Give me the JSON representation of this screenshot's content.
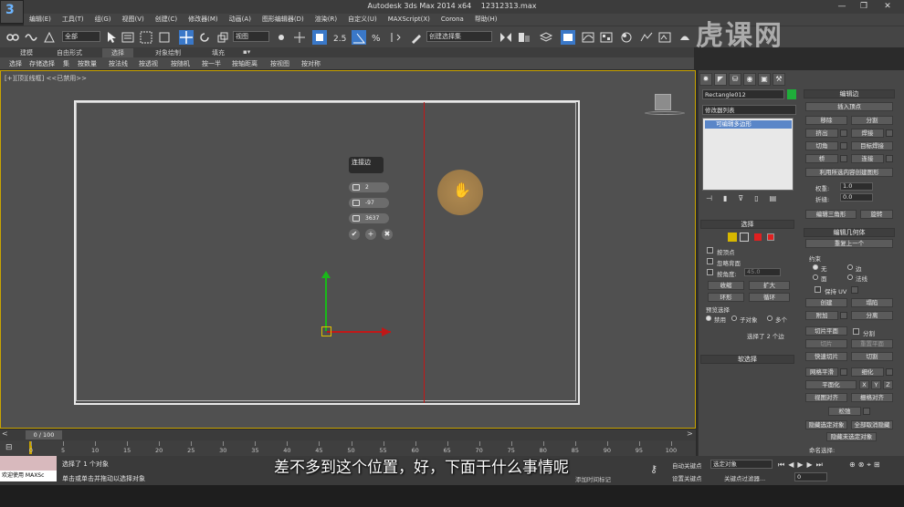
{
  "app": {
    "title_app": "Autodesk 3ds Max  2014 x64",
    "title_file": "12312313.max",
    "logo": "3"
  },
  "menu": [
    "编辑(E)",
    "工具(T)",
    "组(G)",
    "视图(V)",
    "创建(C)",
    "修改器(M)",
    "动画(A)",
    "图形编辑器(D)",
    "渲染(R)",
    "自定义(U)",
    "MAXScript(X)",
    "Corona",
    "帮助(H)"
  ],
  "toolbar": {
    "filter_value": "全部",
    "refcoord_value": "视图",
    "named_sel_value": "创建选择集"
  },
  "ribbon": {
    "tabs": [
      "建模",
      "自由形式",
      "选择",
      "对象绘制",
      "填充"
    ],
    "items": [
      "选择",
      "存储选择",
      "集",
      "按数量",
      "按法线",
      "按透视",
      "按随机",
      "按一半",
      "按轴距离",
      "按视图",
      "按对称"
    ]
  },
  "viewport": {
    "label": "[+][顶][线框]  <<已禁用>>",
    "caddy": {
      "title": "连接边",
      "segments": "2",
      "pinch": "-97",
      "slide": "3637"
    }
  },
  "command_panel": {
    "object_name": "Rectangle012",
    "object_color": "#1fae3a",
    "modifier_list_label": "修改器列表",
    "stack_item": "可编辑多边形",
    "selection": {
      "header": "选择",
      "by_vertex": "按顶点",
      "ignore_backfacing": "忽略背面",
      "by_angle": "按角度:",
      "angle_value": "45.0",
      "shrink": "收缩",
      "grow": "扩大",
      "ring": "环形",
      "loop": "循环",
      "preview_label": "预览选择",
      "preview_opts": [
        "禁用",
        "子对象",
        "多个"
      ],
      "status": "选择了 2 个边"
    },
    "soft_selection": "软选择",
    "edit_edges": {
      "header": "编辑边",
      "insert_vertex": "插入顶点",
      "remove": "移除",
      "split": "分割",
      "extrude": "挤出",
      "weld": "焊接",
      "chamfer": "切角",
      "target_weld": "目标焊接",
      "bridge": "桥",
      "connect": "连接",
      "create_shape": "利用所选内容创建图形",
      "weight_label": "权重:",
      "weight_value": "1.0",
      "crease_label": "折缝:",
      "crease_value": "0.0",
      "edit_tri": "编辑三角形",
      "turn": "旋转"
    },
    "edit_geometry": {
      "header": "编辑几何体",
      "repeat_last": "重复上一个",
      "constraints": "约束",
      "c_none": "无",
      "c_edge": "边",
      "c_face": "面",
      "c_normal": "法线",
      "preserve_uv": "保持 UV",
      "create": "创建",
      "collapse": "塌陷",
      "attach": "附加",
      "detach": "分离",
      "slice_plane": "切片平面",
      "split": "分割",
      "slice": "切片",
      "reset_plane": "重置平面",
      "quickslice": "快速切片",
      "cut": "切割",
      "meshsmooth": "网格平滑",
      "tessellate": "细化",
      "make_planar": "平面化",
      "x": "X",
      "y": "Y",
      "z": "Z",
      "view_align": "视图对齐",
      "grid_align": "栅格对齐",
      "relax": "松弛",
      "hide_sel": "隐藏选定对象",
      "unhide_all": "全部取消隐藏",
      "hide_unsel": "隐藏未选定对象",
      "named_sel": "命名选择:"
    }
  },
  "timeline": {
    "slider": "0 / 100",
    "ticks": [
      "0",
      "5",
      "10",
      "15",
      "20",
      "25",
      "30",
      "35",
      "40",
      "45",
      "50",
      "55",
      "60",
      "65",
      "70",
      "75",
      "80",
      "85",
      "90",
      "95",
      "100"
    ]
  },
  "status": {
    "maxscript": "欢迎使用 MAXSc",
    "selection": "选择了 1 个对象",
    "prompt": "单击或单击并拖动以选择对象",
    "auto_key": "自动关键点",
    "set_key": "设置关键点",
    "selected_obj": "选定对象",
    "key_filters": "关键点过滤器...",
    "add_time_tag": "添加时间标记",
    "frame": "0"
  },
  "subtitle": "差不多到这个位置，好，下面干什么事情呢",
  "watermark": "虎课网"
}
